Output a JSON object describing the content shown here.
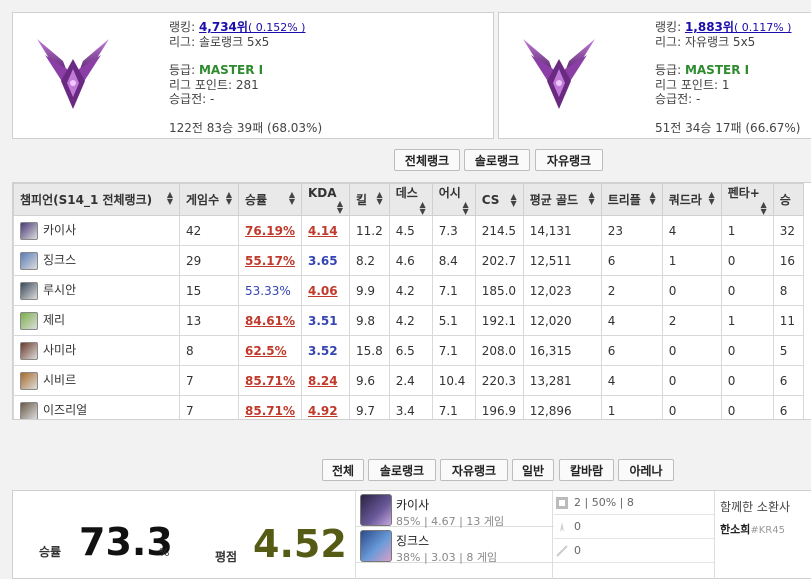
{
  "solo_rank": {
    "ranking_label": "랭킹:",
    "ranking_value": "4,734위",
    "ranking_pct": "( 0.152% )",
    "league_label": "리그:",
    "league_value": "솔로랭크 5x5",
    "tier_label": "등급:",
    "tier_value": "MASTER I",
    "lp_label": "리그 포인트:",
    "lp_value": "281",
    "promo_label": "승급전:",
    "promo_value": "-",
    "record": "122전 83승 39패 (68.03%)"
  },
  "flex_rank": {
    "ranking_label": "랭킹:",
    "ranking_value": "1,883위",
    "ranking_pct": "( 0.117% )",
    "league_label": "리그:",
    "league_value": "자유랭크 5x5",
    "tier_label": "등급:",
    "tier_value": "MASTER I",
    "lp_label": "리그 포인트:",
    "lp_value": "1",
    "promo_label": "승급전:",
    "promo_value": "-",
    "record": "51전 34승 17패 (66.67%)"
  },
  "queue_tabs": [
    "전체랭크",
    "솔로랭크",
    "자유랭크"
  ],
  "table": {
    "headers": [
      "챔피언(S14_1 전체랭크)",
      "게임수",
      "승률",
      "KDA",
      "킬",
      "데스",
      "어시",
      "CS",
      "평균 골드",
      "트리플",
      "쿼드라",
      "펜타+",
      "승"
    ],
    "rows": [
      {
        "champ": "카이사",
        "icon_color": "#4a3a78",
        "games": "42",
        "winrate": "76.19%",
        "wr_style": "hi",
        "kda": "4.14",
        "kda_style": "hi",
        "k": "11.2",
        "d": "4.5",
        "a": "7.3",
        "cs": "214.5",
        "gold": "14,131",
        "triple": "23",
        "quadra": "4",
        "penta": "1",
        "wins": "32"
      },
      {
        "champ": "징크스",
        "icon_color": "#5a7db8",
        "games": "29",
        "winrate": "55.17%",
        "wr_style": "hi",
        "kda": "3.65",
        "kda_style": "mid",
        "k": "8.2",
        "d": "4.6",
        "a": "8.4",
        "cs": "202.7",
        "gold": "12,511",
        "triple": "6",
        "quadra": "1",
        "penta": "0",
        "wins": "16"
      },
      {
        "champ": "루시안",
        "icon_color": "#3b4a5a",
        "games": "15",
        "winrate": "53.33%",
        "wr_style": "mid",
        "kda": "4.06",
        "kda_style": "hi",
        "k": "9.9",
        "d": "4.2",
        "a": "7.1",
        "cs": "185.0",
        "gold": "12,023",
        "triple": "2",
        "quadra": "0",
        "penta": "0",
        "wins": "8"
      },
      {
        "champ": "제리",
        "icon_color": "#7ab04a",
        "games": "13",
        "winrate": "84.61%",
        "wr_style": "hi",
        "kda": "3.51",
        "kda_style": "mid",
        "k": "9.8",
        "d": "4.2",
        "a": "5.1",
        "cs": "192.1",
        "gold": "12,020",
        "triple": "4",
        "quadra": "2",
        "penta": "1",
        "wins": "11"
      },
      {
        "champ": "사미라",
        "icon_color": "#6a3a2a",
        "games": "8",
        "winrate": "62.5%",
        "wr_style": "hi",
        "kda": "3.52",
        "kda_style": "mid",
        "k": "15.8",
        "d": "6.5",
        "a": "7.1",
        "cs": "208.0",
        "gold": "16,315",
        "triple": "6",
        "quadra": "0",
        "penta": "0",
        "wins": "5"
      },
      {
        "champ": "시비르",
        "icon_color": "#a86a2a",
        "games": "7",
        "winrate": "85.71%",
        "wr_style": "hi",
        "kda": "8.24",
        "kda_style": "hi",
        "k": "9.6",
        "d": "2.4",
        "a": "10.4",
        "cs": "220.3",
        "gold": "13,281",
        "triple": "4",
        "quadra": "0",
        "penta": "0",
        "wins": "6"
      },
      {
        "champ": "이즈리얼",
        "icon_color": "#6a5a48",
        "games": "7",
        "winrate": "85.71%",
        "wr_style": "hi",
        "kda": "4.92",
        "kda_style": "hi",
        "k": "9.7",
        "d": "3.4",
        "a": "7.1",
        "cs": "196.9",
        "gold": "12,896",
        "triple": "1",
        "quadra": "0",
        "penta": "0",
        "wins": "6"
      }
    ]
  },
  "match_tabs": [
    "전체",
    "솔로랭크",
    "자유랭크",
    "일반",
    "칼바람",
    "아레나"
  ],
  "summary": {
    "wr_label": "승률",
    "wr_value": "73.3",
    "wr_unit": "%",
    "kda_label": "평점",
    "kda_value": "4.52"
  },
  "recent_champs": [
    {
      "name": "카이사",
      "pct": "85%",
      "kda": "4.67",
      "games": "13 게임",
      "icon_color": "#3f3266"
    },
    {
      "name": "징크스",
      "pct": "38%",
      "kda": "3.03",
      "games": "8 게임",
      "icon_color": "#4f76b8"
    }
  ],
  "positions": [
    {
      "count": "2",
      "pct": "50%",
      "extra": "8"
    },
    {
      "count": "0",
      "pct": "",
      "extra": ""
    },
    {
      "count": "0",
      "pct": "",
      "extra": ""
    }
  ],
  "friends": {
    "title": "함께한 소환사",
    "name": "한소희",
    "tag": "#KR45"
  },
  "colors": {
    "accent_red": "#c0392b",
    "accent_blue": "#3545b0",
    "tier_green": "#2e8b2e",
    "kda_olive": "#555a14"
  }
}
